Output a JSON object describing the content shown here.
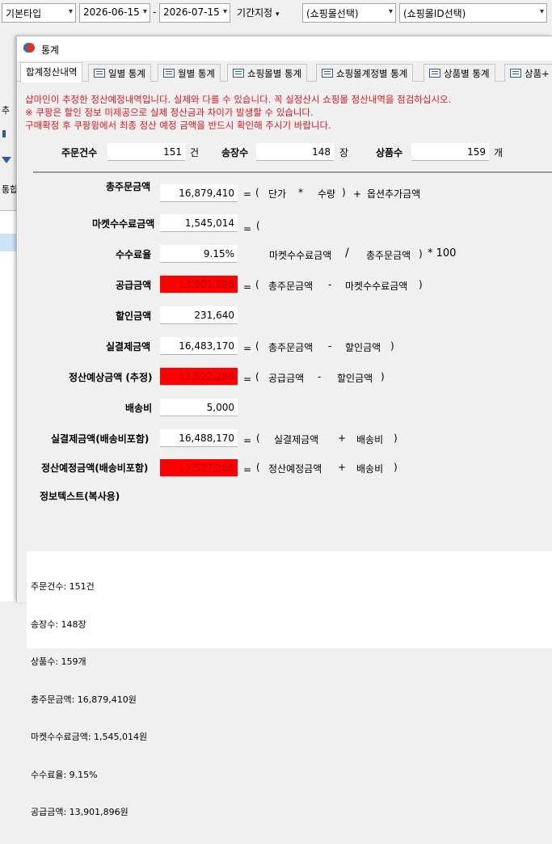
{
  "toolbar": {
    "type_select": "기본타입",
    "date_from": "2026-06-15",
    "date_sep": "-",
    "date_to": "2026-07-15",
    "period_button": "기간지정",
    "mall_select": "(쇼핑몰선택)",
    "mall_id_select": "(쇼핑몰ID선택)"
  },
  "background_fragments": {
    "a": "추",
    "b": "통합"
  },
  "window": {
    "title": "통계"
  },
  "tabs": [
    "합계정산내역",
    "일별 통계",
    "월별 통계",
    "쇼핑몰별 통계",
    "쇼핑몰계정별 통계",
    "상품별 통계",
    "상품+"
  ],
  "notices": [
    "샵마인이 추정한 정산예정내역입니다. 실제와 다를 수 있습니다. 꼭 실정산시 쇼핑몰 정산내역을 점검하십시오.",
    "※ 쿠팡은 할인 정보 미제공으로 실제 정산금과 차이가 발생할 수 있습니다.",
    "구매확정 후 쿠팡윙에서 최종 정산 예정 금액을 반드시 확인해 주시기 바랍니다."
  ],
  "counts": {
    "orders_label": "주문건수",
    "orders_value": "151",
    "orders_unit": "건",
    "invoices_label": "송장수",
    "invoices_value": "148",
    "invoices_unit": "장",
    "products_label": "상품수",
    "products_value": "159",
    "products_unit": "개"
  },
  "rows": {
    "total": {
      "label": "총주문금액",
      "value": "16,879,410"
    },
    "fee": {
      "label": "마켓수수료금액",
      "value": "1,545,014"
    },
    "rate": {
      "label": "수수료율",
      "value": "9.15%"
    },
    "supply": {
      "label": "공급금액",
      "value": "13,901,896"
    },
    "discount": {
      "label": "할인금액",
      "value": "231,640"
    },
    "paid": {
      "label": "실결제금액",
      "value": "16,483,170"
    },
    "settle": {
      "label": "정산예상금액 (추정)",
      "value": "13,522,286"
    },
    "shipping": {
      "label": "배송비",
      "value": "5,000"
    },
    "paid_ship": {
      "label": "실결제금액(배송비포함)",
      "value": "16,488,170"
    },
    "settle_ship": {
      "label": "정산예정금액(배송비포함)",
      "value": "13,527,286"
    }
  },
  "formulas": {
    "total": {
      "eq": "=",
      "lp": "(",
      "a": "단가",
      "op": "*",
      "b": "수량",
      "rp": ")",
      "plus": "+",
      "c": "옵션추가금액"
    },
    "fee": {
      "eq": "=",
      "lp": "("
    },
    "rate": {
      "a": "마켓수수료금액",
      "op": "/",
      "b": "총주문금액",
      "rp": ")",
      "tail": "* 100"
    },
    "supply": {
      "eq": "=",
      "lp": "(",
      "a": "총주문금액",
      "op": "-",
      "b": "마켓수수료금액",
      "rp": ")"
    },
    "paid": {
      "eq": "=",
      "lp": "(",
      "a": "총주문금액",
      "op": "-",
      "b": "할인금액",
      "rp": ")"
    },
    "settle": {
      "eq": "=",
      "lp": "(",
      "a": "공급금액",
      "op": "-",
      "b": "할인금액",
      "rp": ")"
    },
    "paid_ship": {
      "eq": "=",
      "lp": "(",
      "a": "실결제금액",
      "op": "+",
      "b": "배송비",
      "rp": ")"
    },
    "settle_ship": {
      "eq": "=",
      "lp": "(",
      "a": "정산예정금액",
      "op": "+",
      "b": "배송비",
      "rp": ")"
    }
  },
  "info": {
    "label": "정보텍스트(복사용)",
    "lines": [
      "주문건수: 151건",
      "송장수: 148장",
      "상품수: 159개",
      "총주문금액: 16,879,410원",
      "마켓수수료금액: 1,545,014원",
      "수수료율: 9.15%",
      "공급금액: 13,901,896원"
    ]
  },
  "colors": {
    "highlight": "#ff0000",
    "notice": "#e0161b"
  },
  "icons": [
    "chevron-down-icon",
    "window-logo-icon",
    "tab-grid-icon",
    "pause-icon",
    "filter-icon"
  ]
}
